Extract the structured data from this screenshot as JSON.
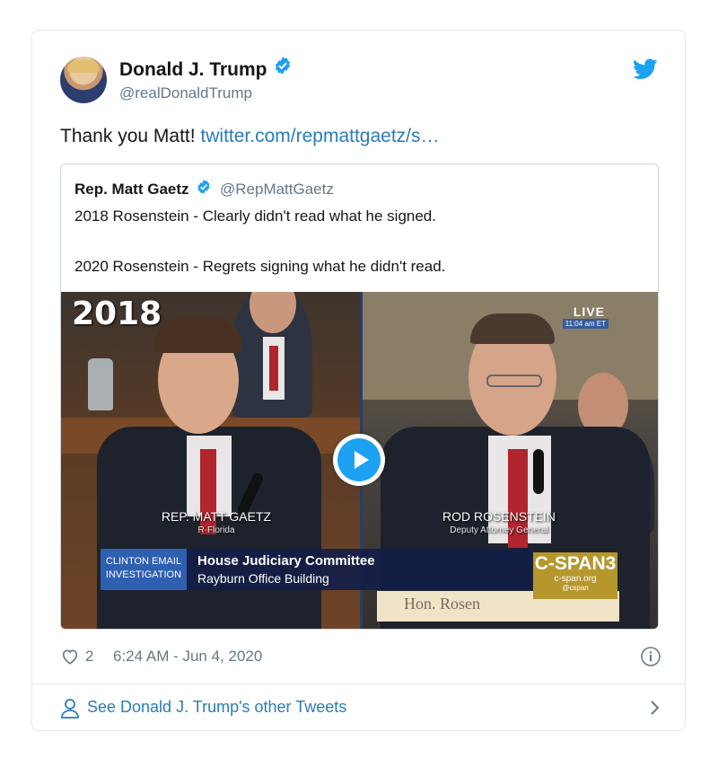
{
  "author": {
    "name": "Donald J. Trump",
    "handle": "@realDonaldTrump",
    "verified": true,
    "avatar": "avatar"
  },
  "tweet": {
    "text_prefix": "Thank you Matt! ",
    "link_text": "twitter.com/repmattgaetz/s…"
  },
  "quoted_tweet": {
    "name": "Rep. Matt Gaetz",
    "handle": "@RepMattGaetz",
    "verified": true,
    "line1": "2018 Rosenstein - Clearly didn't read what he signed.",
    "line2": "2020 Rosenstein - Regrets signing what he didn't read."
  },
  "video": {
    "year_label": "2018",
    "live_label": "LIVE",
    "live_time": "11:04 am ET",
    "left_name": "REP. MATT GAETZ",
    "left_sub": "R-Florida",
    "right_name": "ROD ROSENSTEIN",
    "right_sub": "Deputy Attorney General",
    "chyron_tag_line1": "CLINTON EMAIL",
    "chyron_tag_line2": "INVESTIGATION",
    "chyron_line1": "House Judiciary Committee",
    "chyron_line2": "Rayburn Office Building",
    "cspan_logo": "C-SPAN3",
    "cspan_url": "c-span.org",
    "cspan_twitter": "@cspan",
    "nameplate": "Hon. Rosen"
  },
  "meta": {
    "like_count": "2",
    "timestamp": "6:24 AM - Jun 4, 2020"
  },
  "footer": {
    "link_text": "See Donald J. Trump's other Tweets"
  },
  "colors": {
    "link": "#2b7bb9",
    "twitter_blue": "#1da1f2",
    "muted": "#657786",
    "border": "#e1e8ed"
  },
  "icons": [
    "twitter-bird-icon",
    "verified-badge-icon",
    "play-icon",
    "heart-icon",
    "info-icon",
    "person-icon",
    "chevron-right-icon"
  ]
}
